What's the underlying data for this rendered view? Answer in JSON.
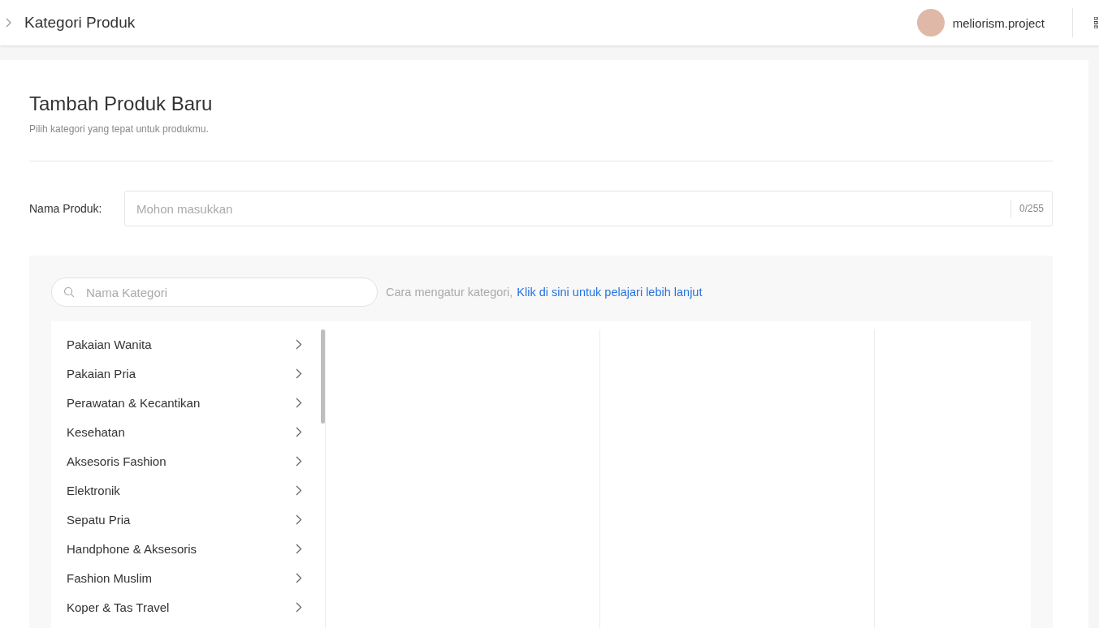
{
  "header": {
    "title": "Kategori Produk",
    "username": "meliorism.project"
  },
  "page": {
    "title": "Tambah Produk Baru",
    "subtitle": "Pilih kategori yang tepat untuk produkmu."
  },
  "product_name": {
    "label": "Nama Produk:",
    "placeholder": "Mohon masukkan",
    "counter": "0/255"
  },
  "category_search": {
    "placeholder": "Nama Kategori",
    "hint": "Cara mengatur kategori,",
    "link": "Klik di sini untuk pelajari lebih lanjut"
  },
  "categories": [
    {
      "label": "Pakaian Wanita"
    },
    {
      "label": "Pakaian Pria"
    },
    {
      "label": "Perawatan & Kecantikan"
    },
    {
      "label": "Kesehatan"
    },
    {
      "label": "Aksesoris Fashion"
    },
    {
      "label": "Elektronik"
    },
    {
      "label": "Sepatu Pria"
    },
    {
      "label": "Handphone & Aksesoris"
    },
    {
      "label": "Fashion Muslim"
    },
    {
      "label": "Koper & Tas Travel"
    }
  ]
}
